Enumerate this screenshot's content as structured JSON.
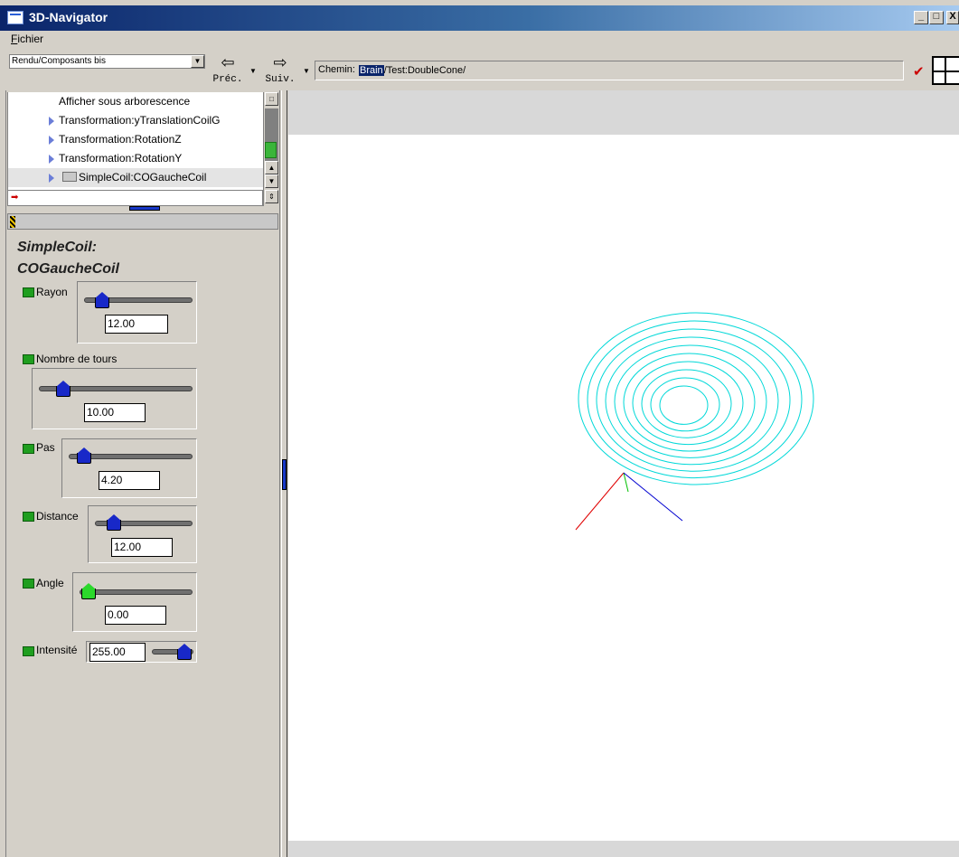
{
  "window": {
    "title": "3D-Navigator",
    "controls": {
      "minimize": "_",
      "maximize": "□",
      "close": "X"
    }
  },
  "menubar": {
    "items": [
      {
        "label": "Fichier",
        "mnemonic": "F",
        "rest": "ichier"
      }
    ]
  },
  "toolbar": {
    "view_select": "Rendu/Composants bis",
    "prev": {
      "label": "Préc.",
      "icon": "arrow-left-icon"
    },
    "next": {
      "label": "Suiv.",
      "icon": "arrow-right-icon"
    },
    "path_label": "Chemin:",
    "path_highlight": "Brain",
    "path_rest": "/Test:DoubleCone/"
  },
  "tree": {
    "items": [
      {
        "label": "Afficher sous arborescence",
        "kind": "action"
      },
      {
        "label": "Transformation:yTranslationCoilG",
        "kind": "node"
      },
      {
        "label": "Transformation:RotationZ",
        "kind": "node"
      },
      {
        "label": "Transformation:RotationY",
        "kind": "node"
      },
      {
        "label": "SimpleCoil:COGaucheCoil",
        "kind": "folder",
        "selected": true
      }
    ]
  },
  "panel": {
    "title_line1": "SimpleCoil:",
    "title_line2": "COGaucheCoil",
    "params": {
      "rayon": {
        "label": "Rayon",
        "value": "12.00",
        "slider_fraction": 0.1
      },
      "tours": {
        "label": "Nombre de tours",
        "value": "10.00",
        "slider_fraction": 0.08
      },
      "pas": {
        "label": "Pas",
        "value": "4.20",
        "slider_fraction": 0.05
      },
      "distance": {
        "label": "Distance",
        "value": "12.00",
        "slider_fraction": 0.12
      },
      "angle": {
        "label": "Angle",
        "value": "0.00",
        "slider_fraction": 0.0
      },
      "intensite": {
        "label": "Intensité",
        "value": "255.00",
        "slider_fraction": 1.0
      }
    }
  },
  "viewport": {
    "coil_color": "#00d8d8",
    "axis_colors": {
      "x": "#e00000",
      "y": "#00c000",
      "z": "#0000d0"
    }
  },
  "colors": {
    "accent": "#0a246a",
    "slider_knob": "#1828c8",
    "slider_knob_active": "#2bd82b",
    "indicator": "#1f9e1f"
  }
}
